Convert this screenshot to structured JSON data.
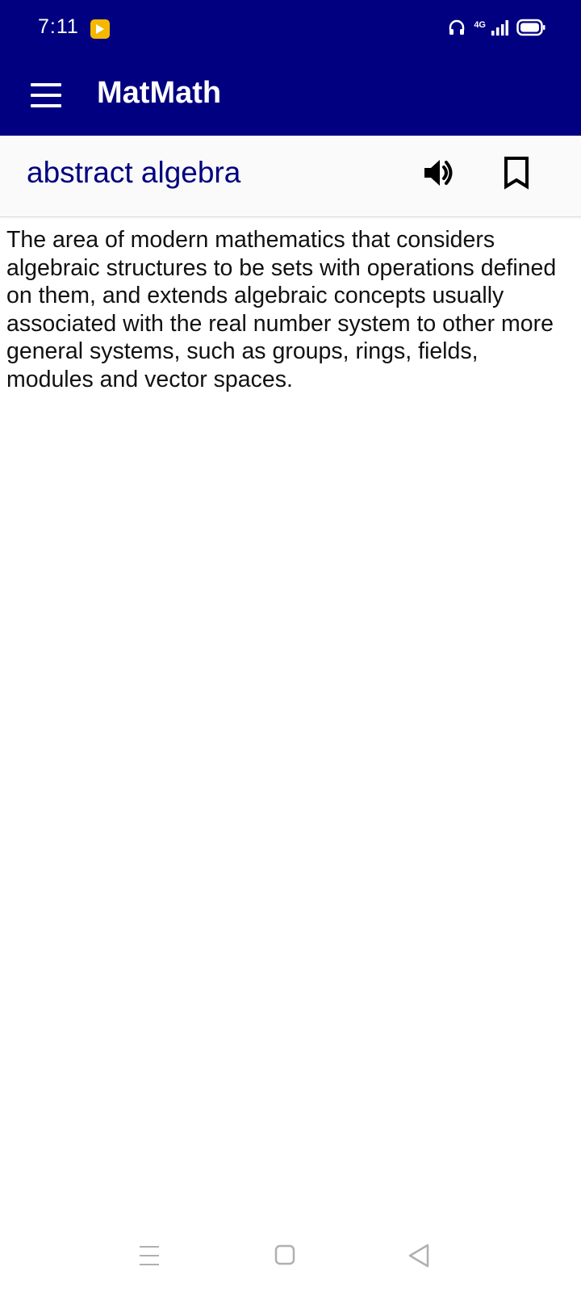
{
  "status_bar": {
    "time": "7:11",
    "network": "4G",
    "app_icon": "play-notification-icon",
    "icons": [
      "headset-icon",
      "signal-icon",
      "battery-icon"
    ]
  },
  "toolbar": {
    "title": "MatMath",
    "menu_icon": "hamburger-menu-icon"
  },
  "entry": {
    "word": "abstract algebra",
    "speak_icon": "speaker-icon",
    "bookmark_icon": "bookmark-icon",
    "definition": "The area of modern mathematics that considers algebraic structures to be sets with operations defined on them, and extends algebraic concepts usually associated with the real number system to other more general systems, such as groups, rings, fields, modules and vector spaces."
  },
  "nav_bar": {
    "icons": [
      "recents-icon",
      "home-icon",
      "back-icon"
    ]
  },
  "colors": {
    "primary": "#000080",
    "status_app_icon": "#f5b800",
    "word_text": "#000080",
    "header_bg": "#fafafa"
  }
}
